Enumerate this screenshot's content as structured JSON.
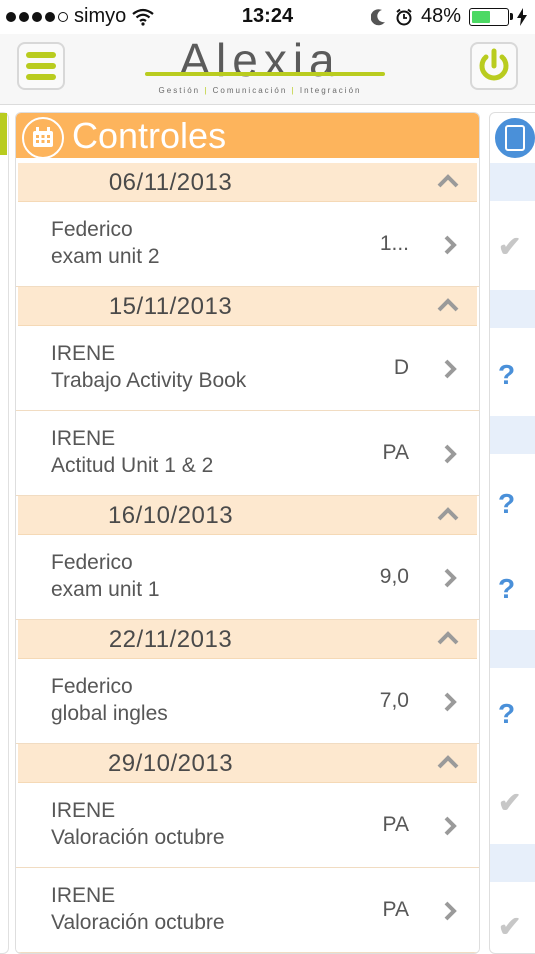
{
  "status_bar": {
    "carrier": "simyo",
    "time": "13:24",
    "battery": "48%"
  },
  "header": {
    "logo_text": "Alexia",
    "logo_tagline_1": "Gestión",
    "logo_tagline_2": "Comunicación",
    "logo_tagline_3": "Integración"
  },
  "panel": {
    "title": "Controles"
  },
  "groups": [
    {
      "date": "06/11/2013",
      "items": [
        {
          "who": "Federico",
          "what": "exam unit 2",
          "grade": "1..."
        }
      ]
    },
    {
      "date": "15/11/2013",
      "items": [
        {
          "who": "IRENE",
          "what": "Trabajo Activity Book",
          "grade": "D"
        },
        {
          "who": "IRENE",
          "what": "Actitud Unit 1 & 2",
          "grade": "PA"
        }
      ]
    },
    {
      "date": "16/10/2013",
      "items": [
        {
          "who": "Federico",
          "what": "exam unit 1",
          "grade": "9,0"
        }
      ]
    },
    {
      "date": "22/11/2013",
      "items": [
        {
          "who": "Federico",
          "what": "global ingles",
          "grade": "7,0"
        }
      ]
    },
    {
      "date": "29/10/2013",
      "items": [
        {
          "who": "IRENE",
          "what": "Valoración octubre",
          "grade": "PA"
        },
        {
          "who": "IRENE",
          "what": "Valoración octubre",
          "grade": "PA"
        }
      ]
    }
  ],
  "right_panel_marks": [
    "✔",
    "?",
    "?",
    "?",
    "?",
    "✔",
    "✔"
  ],
  "colors": {
    "accent_green": "#b9cc1f",
    "panel_orange": "#fdb45c",
    "date_bg": "#fde8cf",
    "question_blue": "#4a90d9"
  }
}
